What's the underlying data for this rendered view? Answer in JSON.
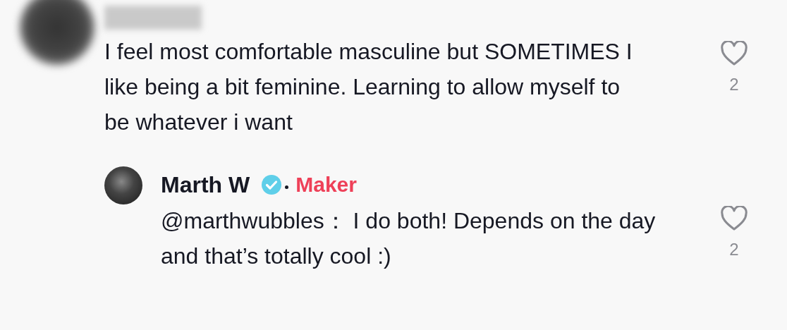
{
  "comments": [
    {
      "author_blurred": true,
      "text": "I feel most comfortable masculine but SOMETIMES I like being a bit feminine. Learning to allow myself to be whatever i want",
      "likes": "2",
      "liked": false,
      "replies": [
        {
          "author": "Marth W",
          "verified": true,
          "badge": "Maker",
          "text": "@marthwubbles：  I do both! Depends on the day and that’s totally cool :)",
          "likes": "2",
          "liked": false
        }
      ]
    }
  ]
}
